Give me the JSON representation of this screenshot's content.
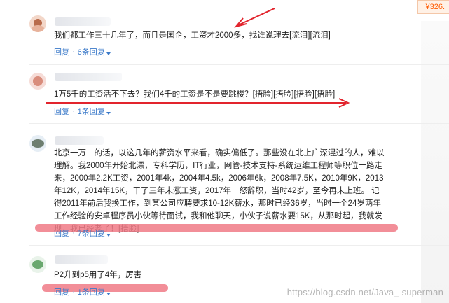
{
  "price_chip": {
    "icon": "yuan-sign",
    "text": "¥326."
  },
  "comments": [
    {
      "avatar_colors": [
        "#f3d7c9",
        "#b86b4b"
      ],
      "text": "我们都工作三十几年了，而且是国企，工资才2000多，找谁说理去[流泪][流泪]",
      "reply_label": "回复",
      "replies_label": "6条回复"
    },
    {
      "avatar_colors": [
        "#f6dcd7",
        "#d98d7c"
      ],
      "text": "1万5千的工资活不下去？我们4千的工资是不是要跳楼？[捂脸][捂脸][捂脸][捂脸]",
      "reply_label": "回复",
      "replies_label": "1条回复"
    },
    {
      "avatar_colors": [
        "#e6eef5",
        "#6d7e70"
      ],
      "text": "北京一万二的话，以这几年的薪资水平来看，确实偏低了。那些没在北上广深混过的人，难以理解。我2000年开始北漂，专科学历，IT行业，网管-技术支持-系统运维工程师等职位一路走来，2000年2.2K工资，2001年4k，2004年4.5k，2006年6k，2008年7.5K，2010年9K，2013年12K，2014年15K，干了三年未涨工资，2017年一怒辞职，当时42岁，至今再未上班。 记得2011年前后我换工作，到某公司应聘要求10-12K薪水，那时已经36岁，当时一个24岁两年工作经验的安卓程序员小伙等待面试，我和他聊天，小伙子说薪水要15K，从那时起，我就发现，我已经老了！[捂脸]",
      "reply_label": "回复",
      "replies_label": "7条回复"
    },
    {
      "avatar_colors": [
        "#e9f3ea",
        "#6aa86f"
      ],
      "text": "P2升到p5用了4年，厉害",
      "reply_label": "回复",
      "replies_label": "1条回复"
    }
  ],
  "watermark": "https://blog.csdn.net/Java_   superman",
  "annotation_color": "#e2242d",
  "highlight_color": "#f07a86"
}
